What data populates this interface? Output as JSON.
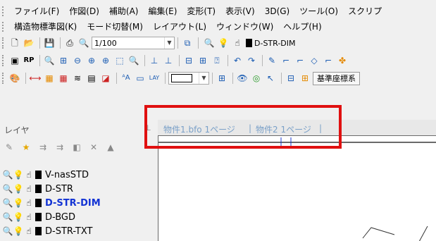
{
  "menu1": [
    "ファイル(F)",
    "作図(D)",
    "補助(A)",
    "編集(E)",
    "変形(T)",
    "表示(V)",
    "3D(G)",
    "ツール(O)",
    "スクリプ"
  ],
  "menu2": [
    "構造物標準図(K)",
    "モード切替(M)",
    "レイアウト(L)",
    "ウィンドウ(W)",
    "ヘルプ(H)"
  ],
  "toolbar1": {
    "scale_value": "1/100",
    "current_layer": "D-STR-DIM"
  },
  "toolbar4": {
    "coord_button": "基準座標系"
  },
  "layer_panel": {
    "title": "レイヤ",
    "layers": [
      {
        "name": "V-nasSTD",
        "active": false
      },
      {
        "name": "D-STR",
        "active": false
      },
      {
        "name": "D-STR-DIM",
        "active": true
      },
      {
        "name": "D-BGD",
        "active": false
      },
      {
        "name": "D-STR-TXT",
        "active": false
      }
    ]
  },
  "tabs": [
    "物件1.bfo 1ページ",
    "物件2 1ページ"
  ],
  "colors": {
    "highlight": "#e01010",
    "active_layer": "#1233d4",
    "tab_text": "#7aa0c8"
  }
}
